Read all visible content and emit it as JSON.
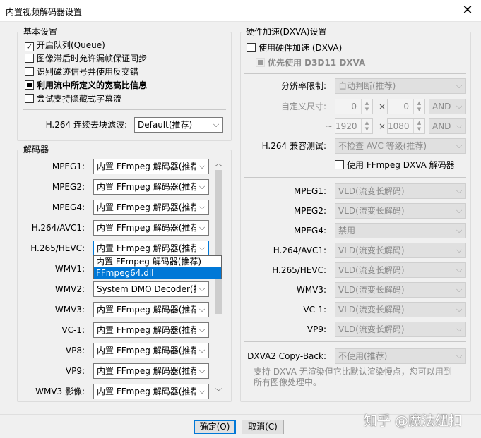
{
  "window": {
    "title": "内置视频解码器设置",
    "close_glyph": "✕"
  },
  "basic": {
    "title": "基本设置",
    "queue": {
      "label": "开启队列(Queue)",
      "checked": true
    },
    "allow_drop": {
      "label": "图像滞后时允许漏帧保证同步",
      "checked": false
    },
    "interlace": {
      "label": "识别磁迹信号并使用反交错",
      "checked": false
    },
    "aspect": {
      "label": "利用流中所定义的宽高比信息",
      "checked": "partial"
    },
    "subs": {
      "label": "尝试支持隐藏式字幕流",
      "checked": false
    },
    "deblock_label": "H.264 连续去块滤波:",
    "deblock_value": "Default(推荐)"
  },
  "decoders": {
    "title": "解码器",
    "rows": [
      {
        "label": "MPEG1:",
        "value": "内置 FFmpeg 解码器(推荐)"
      },
      {
        "label": "MPEG2:",
        "value": "内置 FFmpeg 解码器(推荐)"
      },
      {
        "label": "MPEG4:",
        "value": "内置 FFmpeg 解码器(推荐)"
      },
      {
        "label": "H.264/AVC1:",
        "value": "内置 FFmpeg 解码器(推荐)"
      },
      {
        "label": "H.265/HEVC:",
        "value": "内置 FFmpeg 解码器(推荐)"
      },
      {
        "label": "WMV1:",
        "value": "内置 FFmpeg 解码器(推荐)"
      },
      {
        "label": "WMV2:",
        "value": "System DMO Decoder(推荐)"
      },
      {
        "label": "WMV3:",
        "value": "内置 FFmpeg 解码器(推荐)"
      },
      {
        "label": "VC-1:",
        "value": "内置 FFmpeg 解码器(推荐)"
      },
      {
        "label": "VP8:",
        "value": "内置 FFmpeg 解码器(推荐)"
      },
      {
        "label": "VP9:",
        "value": "内置 FFmpeg 解码器(推荐)"
      },
      {
        "label": "WMV3 影像:",
        "value": "内置 FFmpeg 解码器(推荐)"
      }
    ],
    "dropdown_options": [
      "内置 FFmpeg 解码器(推荐)",
      "FFmpeg64.dll"
    ],
    "dropdown_highlighted": 1
  },
  "hw": {
    "title": "硬件加速(DXVA)设置",
    "use_hw": {
      "label": "使用硬件加速 (DXVA)",
      "checked": false
    },
    "prefer_d3d11": {
      "label": "优先使用 D3D11 DXVA",
      "checked": "partial"
    },
    "resolution_label": "分辨率限制:",
    "resolution_value": "自动判断(推荐)",
    "custom_size_label": "自定义尺寸:",
    "min_w": "0",
    "min_h": "0",
    "min_op": "AND",
    "tilde": "~",
    "max_w": "1920",
    "max_h": "1080",
    "max_op": "AND",
    "times": "×",
    "compat_label": "H.264 兼容测试:",
    "compat_value": "不检查 AVC 等级(推荐)",
    "ffmpeg_dxva": {
      "label": "使用 FFmpeg DXVA 解码器",
      "checked": false
    },
    "codecs": [
      {
        "label": "MPEG1:",
        "value": "VLD(流变长解码)"
      },
      {
        "label": "MPEG2:",
        "value": "VLD(流变长解码)"
      },
      {
        "label": "MPEG4:",
        "value": "禁用"
      },
      {
        "label": "H.264/AVC1:",
        "value": "VLD(流变长解码)"
      },
      {
        "label": "H.265/HEVC:",
        "value": "VLD(流变长解码)"
      },
      {
        "label": "WMV3:",
        "value": "VLD(流变长解码)"
      },
      {
        "label": "VC-1:",
        "value": "VLD(流变长解码)"
      },
      {
        "label": "VP9:",
        "value": "VLD(流变长解码)"
      }
    ],
    "copyback_label": "DXVA2 Copy-Back:",
    "copyback_value": "不使用(推荐)",
    "hint_line1": "支持 DXVA 无渲染但它比默认渲染慢点，您可以用到",
    "hint_line2": "所有图像处理中。"
  },
  "buttons": {
    "ok": "确定(O)",
    "cancel": "取消(C)"
  },
  "watermark": "知乎 @魔法纽扣",
  "colors": {
    "accent": "#0078d7",
    "disabled_text": "#8a8a8a",
    "background": "#f0f0f0"
  }
}
